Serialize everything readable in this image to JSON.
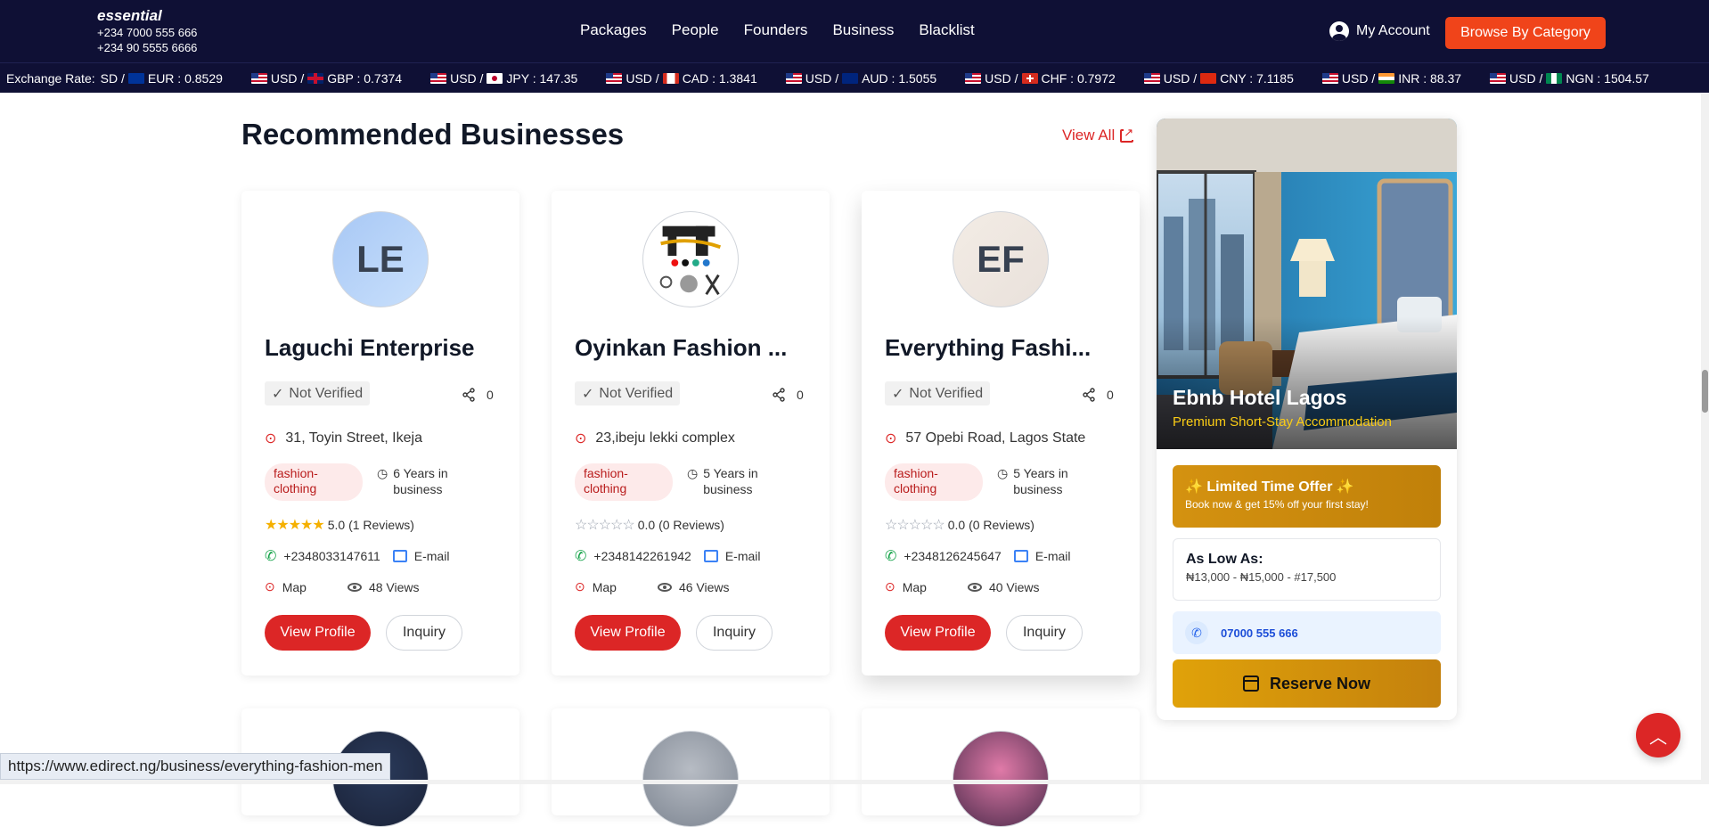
{
  "brand": {
    "name": "essential",
    "phones": [
      "+234 7000 555 666",
      "+234 90 5555 6666"
    ]
  },
  "nav": {
    "links": [
      "Packages",
      "People",
      "Founders",
      "Business",
      "Blacklist"
    ],
    "account": "My Account",
    "browse": "Browse By Category"
  },
  "exchange": {
    "label": "Exchange Rate:",
    "rates": [
      {
        "pair": "SD / ",
        "to": "EUR : 0.8529",
        "flag": "eu",
        "lead": false
      },
      {
        "pair": "USD / ",
        "to": "GBP : 0.7374",
        "flag": "gb",
        "lead": true
      },
      {
        "pair": "USD / ",
        "to": "JPY : 147.35",
        "flag": "jp",
        "lead": true
      },
      {
        "pair": "USD / ",
        "to": "CAD : 1.3841",
        "flag": "ca",
        "lead": true
      },
      {
        "pair": "USD / ",
        "to": "AUD : 1.5055",
        "flag": "au",
        "lead": true
      },
      {
        "pair": "USD / ",
        "to": "CHF : 0.7972",
        "flag": "ch",
        "lead": true
      },
      {
        "pair": "USD / ",
        "to": "CNY : 7.1185",
        "flag": "cn",
        "lead": true
      },
      {
        "pair": "USD / ",
        "to": "INR : 88.37",
        "flag": "in",
        "lead": true
      },
      {
        "pair": "USD / ",
        "to": "NGN : 1504.57",
        "flag": "ng",
        "lead": true
      }
    ]
  },
  "section": {
    "title": "Recommended Businesses",
    "view_all": "View All"
  },
  "cards": [
    {
      "initials": "LE",
      "name": "Laguchi Enterprise",
      "verified": "Not Verified",
      "shares": "0",
      "address": "31, Toyin Street, Ikeja",
      "tag": "fashion-clothing",
      "years": "6 Years in business",
      "rating_text": "5.0 (1 Reviews)",
      "stars": 5,
      "phone": "+2348033147611",
      "email": "E-mail",
      "map": "Map",
      "views": "48 Views",
      "view_profile": "View Profile",
      "inquiry": "Inquiry"
    },
    {
      "initials": "",
      "name": "Oyinkan Fashion ...",
      "verified": "Not Verified",
      "shares": "0",
      "address": "23,ibeju lekki complex",
      "tag": "fashion-clothing",
      "years": "5 Years in business",
      "rating_text": "0.0 (0 Reviews)",
      "stars": 0,
      "phone": "+2348142261942",
      "email": "E-mail",
      "map": "Map",
      "views": "46 Views",
      "view_profile": "View Profile",
      "inquiry": "Inquiry"
    },
    {
      "initials": "EF",
      "name": "Everything Fashi...",
      "verified": "Not Verified",
      "shares": "0",
      "address": "57 Opebi Road, Lagos State",
      "tag": "fashion-clothing",
      "years": "5 Years in business",
      "rating_text": "0.0 (0 Reviews)",
      "stars": 0,
      "phone": "+2348126245647",
      "email": "E-mail",
      "map": "Map",
      "views": "40 Views",
      "view_profile": "View Profile",
      "inquiry": "Inquiry"
    }
  ],
  "ad": {
    "name": "Ebnb Hotel Lagos",
    "subtitle": "Premium Short-Stay Accommodation",
    "offer_title": "✨ Limited Time Offer ✨",
    "offer_desc": "Book now & get 15% off your first stay!",
    "price_title": "As Low As:",
    "price_desc": "₦13,000 - ₦15,000 - #17,500",
    "phone": "07000 555 666",
    "reserve": "Reserve Now"
  },
  "status_url": "https://www.edirect.ng/business/everything-fashion-men",
  "colors": {
    "nav_bg": "#0f1035",
    "accent": "#dc2626",
    "browse": "#f0441a",
    "gold": "#d49210"
  }
}
